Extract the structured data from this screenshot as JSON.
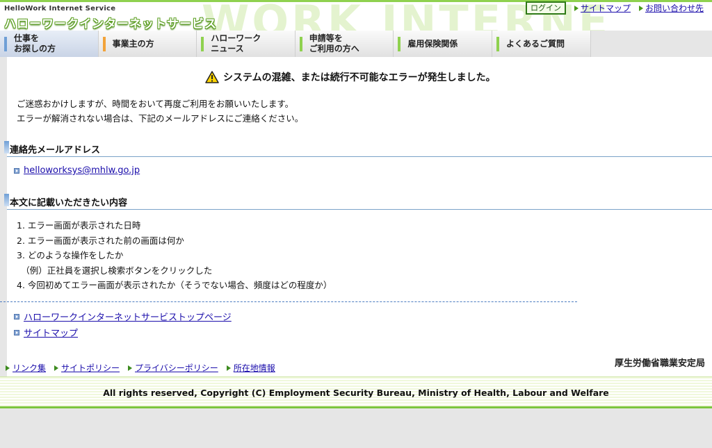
{
  "header": {
    "bg_text": "WORK INTERNE",
    "logo_sub": "HelloWork Internet Service",
    "logo_main": "ハローワークインターネットサービス",
    "login_label": "ログイン",
    "sitemap_label": "サイトマップ",
    "contact_label": "お問い合わせ先"
  },
  "nav": {
    "items": [
      {
        "line1": "仕事を",
        "line2": "お探しの方",
        "color": "#6f9fd6"
      },
      {
        "line1": "事業主の方",
        "line2": "",
        "color": "#f2a33a"
      },
      {
        "line1": "ハローワーク",
        "line2": "ニュース",
        "color": "#8fd14f"
      },
      {
        "line1": "申請等を",
        "line2": "ご利用の方へ",
        "color": "#8fd14f"
      },
      {
        "line1": "雇用保険関係",
        "line2": "",
        "color": "#8fd14f"
      },
      {
        "line1": "よくあるご質問",
        "line2": "",
        "color": "#8fd14f"
      }
    ]
  },
  "main": {
    "error_title": "システムの混雑、または続行不可能なエラーが発生しました。",
    "intro_line1": "ご迷惑おかけしますが、時間をおいて再度ご利用をお願いいたします。",
    "intro_line2": "エラーが解消されない場合は、下記のメールアドレスにご連絡ください。",
    "section1_title": "連絡先メールアドレス",
    "email": "helloworksys@mhlw.go.jp",
    "section2_title": "本文に記載いただきたい内容",
    "list": [
      "1. エラー画面が表示された日時",
      "2. エラー画面が表示された前の画面は何か",
      "3. どのような操作をしたか",
      "　（例）正社員を選択し検索ボタンをクリックした",
      "4. 今回初めてエラー画面が表示されたか（そうでない場合、頻度はどの程度か）"
    ],
    "top_link": "ハローワークインターネットサービストップページ",
    "sitemap_link": "サイトマップ"
  },
  "footer": {
    "links": [
      "リンク集",
      "サイトポリシー",
      "プライバシーポリシー",
      "所在地情報"
    ],
    "ministry": "厚生労働省職業安定局",
    "copyright": "All rights reserved, Copyright (C) Employment Security Bureau, Ministry of Health, Labour and Welfare"
  }
}
